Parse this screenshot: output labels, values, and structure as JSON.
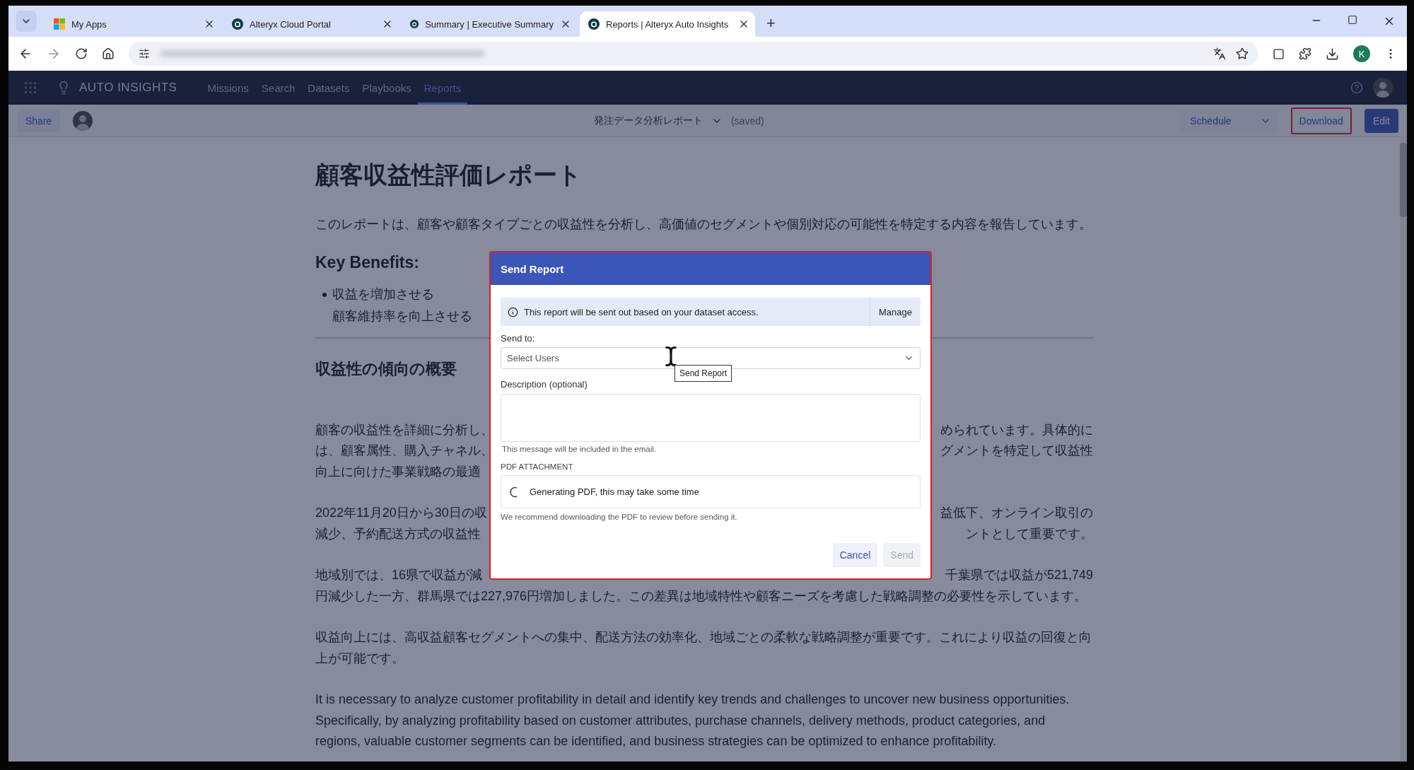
{
  "browser": {
    "tabs": [
      {
        "title": "My Apps",
        "kind": "tiles",
        "selected": false
      },
      {
        "title": "Alteryx Cloud Portal",
        "kind": "circle",
        "selected": false
      },
      {
        "title": "Summary | Executive Summary",
        "kind": "circle",
        "selected": false
      },
      {
        "title": "Reports | Alteryx Auto Insights",
        "kind": "circle",
        "selected": true
      }
    ],
    "new_tab": "+",
    "profile_initial": "K"
  },
  "app": {
    "brand": "AUTO INSIGHTS",
    "nav": [
      {
        "label": "Missions",
        "selected": false
      },
      {
        "label": "Search",
        "selected": false
      },
      {
        "label": "Datasets",
        "selected": false
      },
      {
        "label": "Playbooks",
        "selected": false
      },
      {
        "label": "Reports",
        "selected": true
      }
    ]
  },
  "report_bar": {
    "share": "Share",
    "title": "発注データ分析レポート",
    "status": "(saved)",
    "schedule": "Schedule",
    "download": {
      "label": "Download",
      "highlighted": true
    },
    "edit": "Edit"
  },
  "report": {
    "title": "顧客収益性評価レポート",
    "intro": "このレポートは、顧客や顧客タイプごとの収益性を分析し、高価値のセグメントや個別対応の可能性を特定する内容を報告しています。",
    "benefits_heading": "Key Benefits:",
    "benefits": [
      {
        "text": "収益を増加させる",
        "bullet": true
      },
      {
        "text": "顧客維持率を向上させる",
        "bullet": false
      }
    ],
    "section_heading": "収益性の傾向の概要",
    "partial_paragraphs": [
      {
        "lines": [
          {
            "left": "顧客の収益性を詳細に分析し、",
            "right": "められています。具体的に"
          },
          {
            "left": "は、顧客属性、購入チャネル、",
            "right": "グメントを特定して収益性"
          },
          {
            "left": "向上に向けた事業戦略の最適"
          }
        ]
      },
      {
        "lines": [
          {
            "left": "2022年11月20日から30日の収",
            "right": "益低下、オンライン取引の"
          },
          {
            "left": "減少、予約配送方式の収益性",
            "right": "ントとして重要です。"
          }
        ]
      },
      {
        "lines": [
          {
            "left": "地域別では、16県で収益が減",
            "right": "千葉県では収益が521,749"
          },
          {
            "left": "円減少した一方、群馬県では227,976円増加しました。この差異は地域特性や顧客ニーズを考慮した戦略調整の必要性を示しています。"
          }
        ]
      }
    ],
    "paragraphs": [
      "収益向上には、高収益顧客セグメントへの集中、配送方法の効率化、地域ごとの柔軟な戦略調整が重要です。これにより収益の回復と向上が可能です。",
      "It is necessary to analyze customer profitability in detail and identify key trends and challenges to uncover new business opportunities. Specifically, by analyzing profitability based on customer attributes, purchase channels, delivery methods, product categories, and regions, valuable customer segments can be identified, and business strategies can be optimized to enhance profitability."
    ]
  },
  "dialog": {
    "title": "Send Report",
    "highlighted": true,
    "notice": "This report will be sent out based on your dataset access.",
    "manage": "Manage",
    "send_to_label": "Send to:",
    "send_to_placeholder": "Select Users",
    "tooltip": "Send Report",
    "description_label": "Description (optional)",
    "description_hint": "This message will be included in the email.",
    "attachment_label": "PDF ATTACHMENT",
    "attachment_status": "Generating PDF, this may take some time",
    "attachment_hint": "We recommend downloading the PDF to review before sending it.",
    "buttons": [
      {
        "label": "Cancel",
        "disabled": false
      },
      {
        "label": "Send",
        "disabled": true
      }
    ]
  }
}
